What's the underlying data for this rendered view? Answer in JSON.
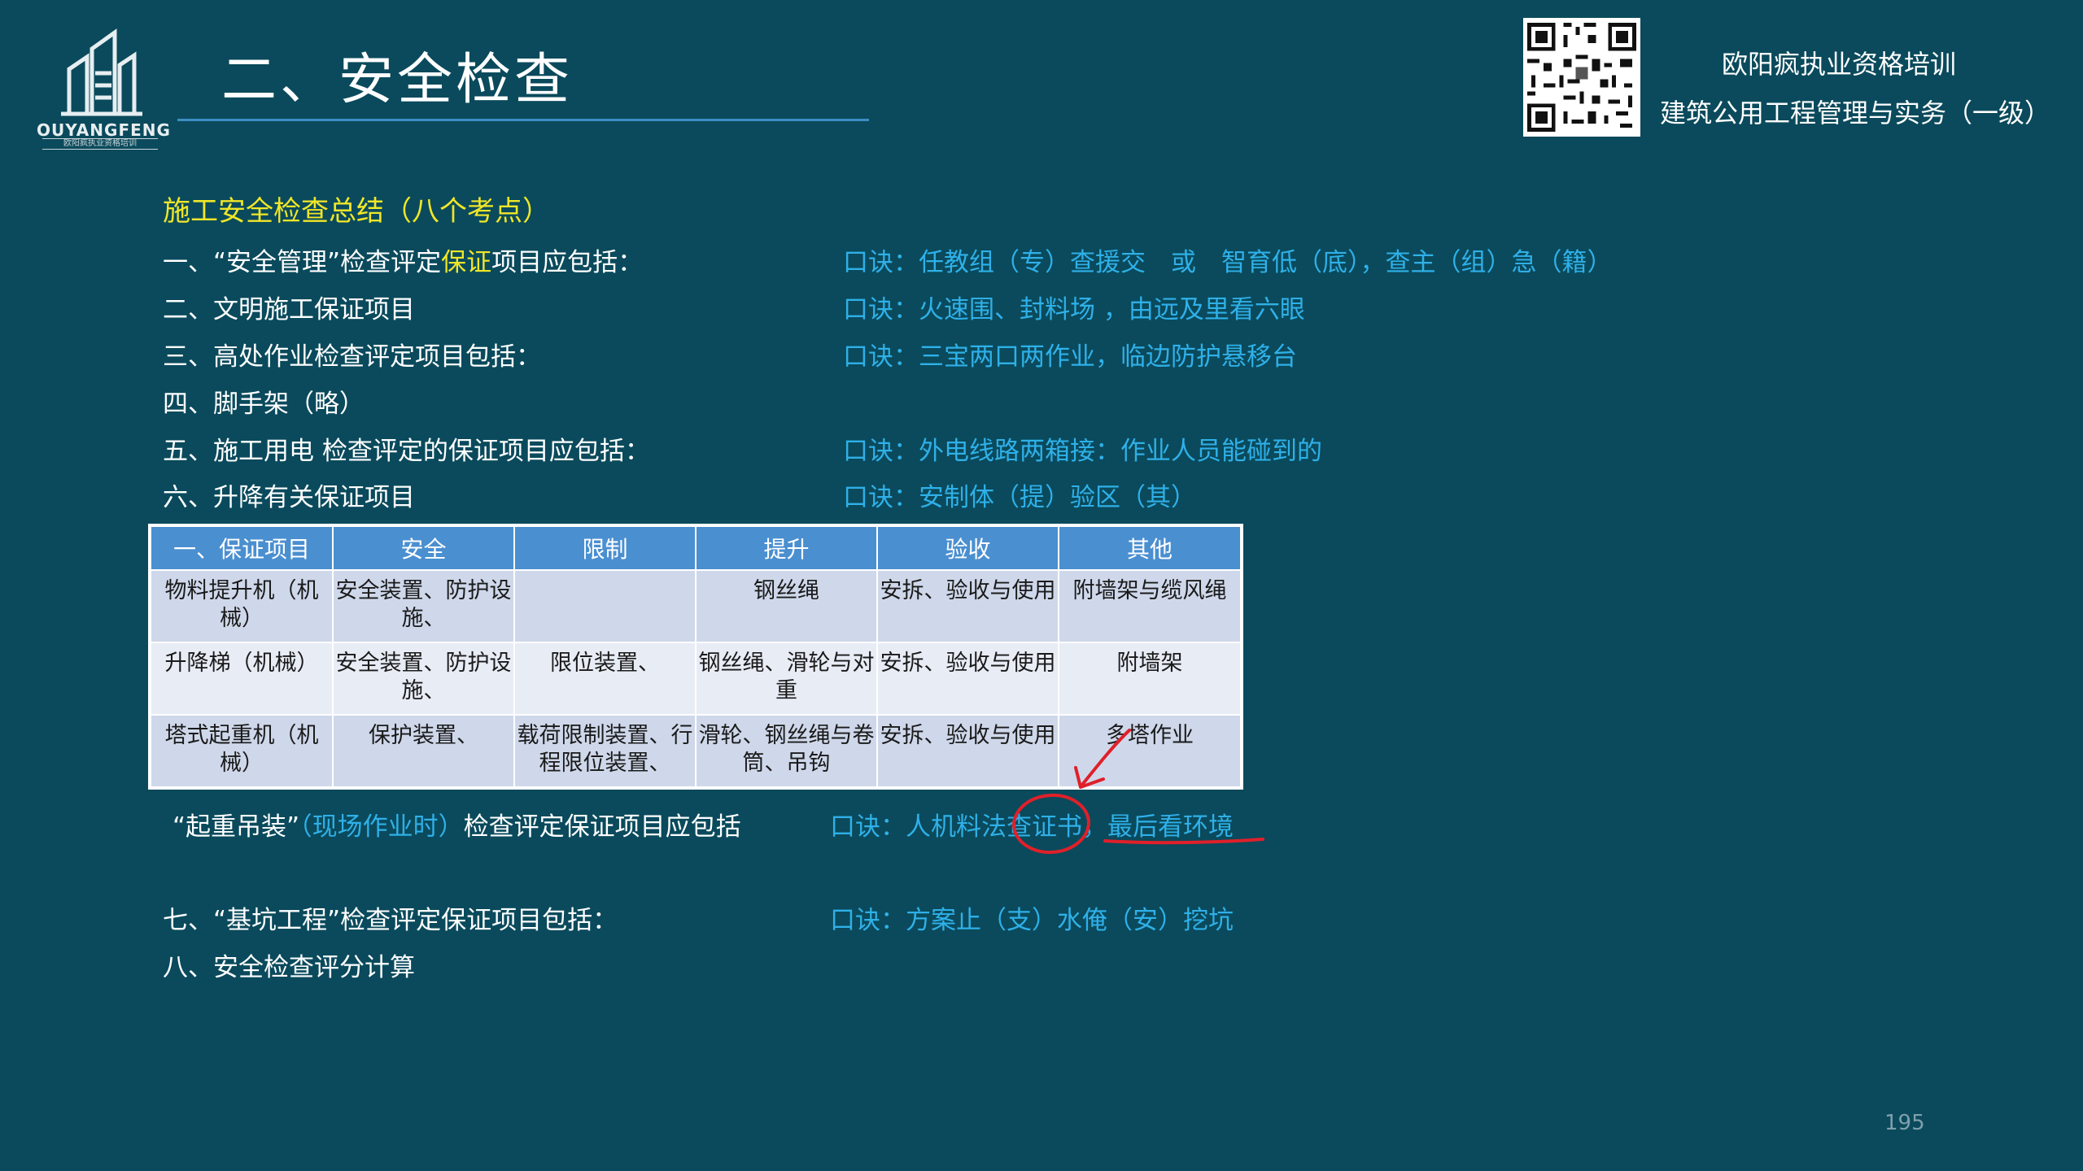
{
  "header": {
    "logo_name": "OUYANGFENG",
    "logo_sub": "欧阳疯执业资格培训",
    "title": "二、安全检查",
    "brand_line1": "欧阳疯执业资格培训",
    "brand_line2": "建筑公用工程管理与实务（一级）"
  },
  "content": {
    "heading": "施工安全检查总结（八个考点）",
    "item1_pre": "一、“安全管理”检查评定",
    "item1_highlight": "保证",
    "item1_post": "项目应包括：",
    "item1_mnemonic": "口诀：任教组（专）查援交　或　智育低（底），查主（组）急（籍）",
    "item2": "二、文明施工保证项目",
    "item2_mnemonic": "口诀：火速围、封料场 ，由远及里看六眼",
    "item3": "三、高处作业检查评定项目包括：",
    "item3_mnemonic": "口诀：三宝两口两作业，临边防护悬移台",
    "item4": "四、脚手架（略）",
    "item5": "五、施工用电 检查评定的保证项目应包括：",
    "item5_mnemonic": "口诀：外电线路两箱接：作业人员能碰到的",
    "item6": "六、升降有关保证项目",
    "item6_mnemonic": "口诀：安制体（提）验区（其）",
    "crane_pre": "“起重吊装”",
    "crane_mid": "（现场作业时）",
    "crane_post": "检查评定保证项目应包括",
    "crane_mnemonic": "口诀：人机料法查证书，最后看环境",
    "item7": "七、“基坑工程”检查评定保证项目包括：",
    "item7_mnemonic": "口诀：方案止（支）水俺（安）挖坑",
    "item8": "八、安全检查评分计算"
  },
  "table": {
    "headers": [
      "一、保证项目",
      "安全",
      "限制",
      "提升",
      "验收",
      "其他"
    ],
    "rows": [
      [
        "物料提升机（机械）",
        "安全装置、防护设施、",
        "",
        "钢丝绳",
        "安拆、验收与使用",
        "附墙架与缆风绳"
      ],
      [
        "升降梯（机械）",
        "安全装置、防护设施、",
        "限位装置、",
        "钢丝绳、滑轮与对重",
        "安拆、验收与使用",
        "附墙架"
      ],
      [
        "塔式起重机（机械）",
        "保护装置、",
        "载荷限制装置、行程限位装置、",
        "滑轮、钢丝绳与卷筒、吊钩",
        "安拆、验收与使用",
        "多塔作业"
      ]
    ]
  },
  "page_number": "195",
  "colors": {
    "background": "#0a4a5c",
    "heading_yellow": "#f0e628",
    "mnemonic_blue": "#2fb0e8",
    "table_header": "#4a8fd0",
    "annotation_red": "#e0202a"
  }
}
